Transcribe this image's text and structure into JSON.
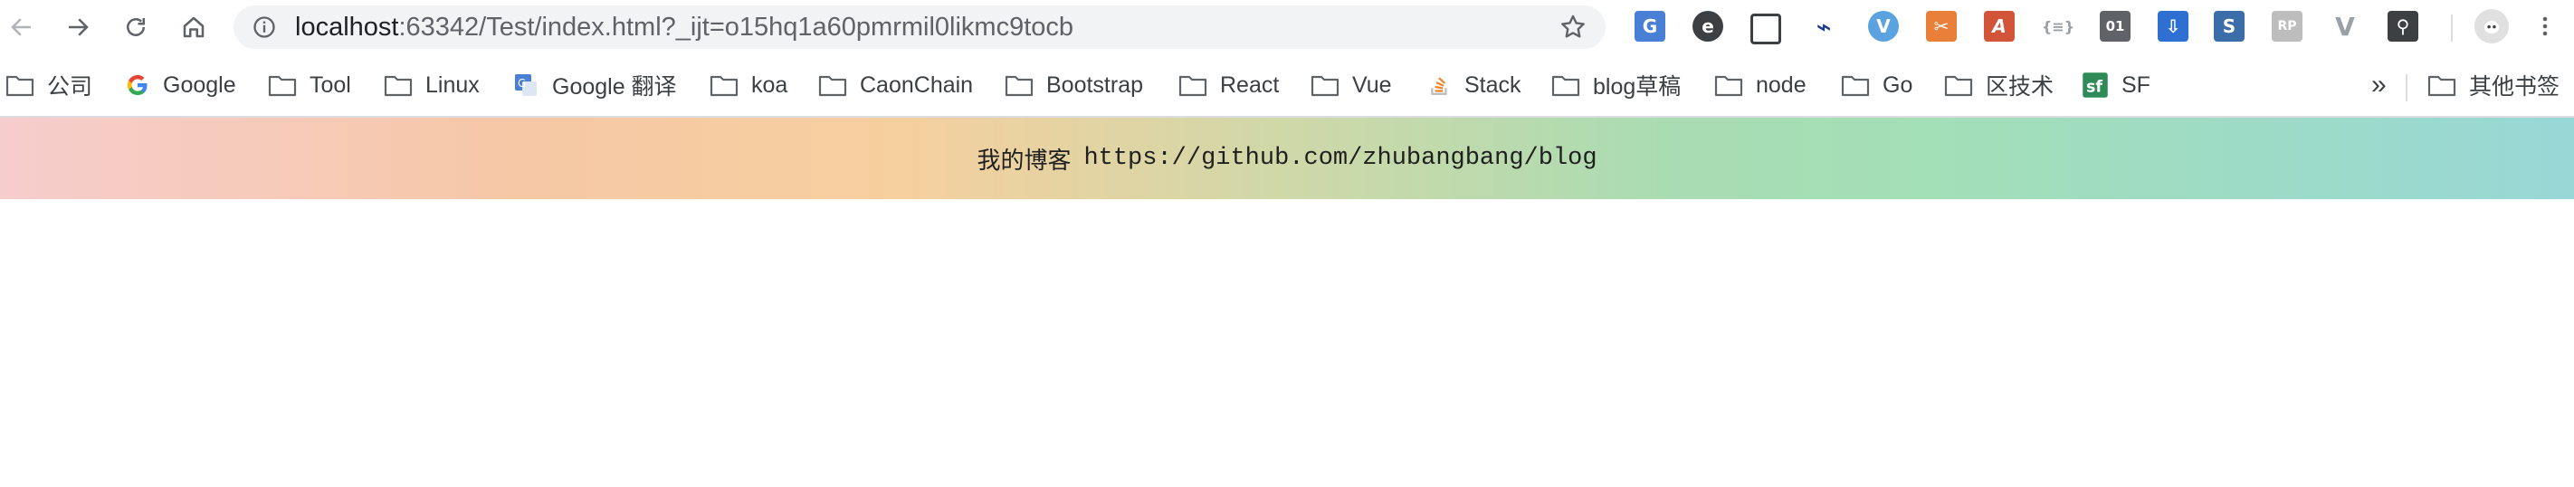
{
  "toolbar": {
    "back_icon": "arrow-left-icon",
    "forward_icon": "arrow-right-icon",
    "reload_icon": "reload-icon",
    "home_icon": "home-icon",
    "url_host": "localhost",
    "url_rest": ":63342/Test/index.html?_ijt=o15hq1a60pmrmil0likmc9tocb",
    "info_icon": "info-icon",
    "bookmark_star_icon": "star-icon"
  },
  "extensions": [
    {
      "name": "google-translate-ext",
      "glyph": "G",
      "color": "#4a7fd6"
    },
    {
      "name": "e-ext",
      "glyph": "e",
      "color": "#3c4043"
    },
    {
      "name": "screenshot-ext",
      "glyph": "▢",
      "color": "#3c4043"
    },
    {
      "name": "pin-ext",
      "glyph": "⌁",
      "color": "#1a3a8f"
    },
    {
      "name": "vimium-ext",
      "glyph": "V",
      "color": "#5aa3e0"
    },
    {
      "name": "tool-ext",
      "glyph": "✂",
      "color": "#e8803a"
    },
    {
      "name": "font-ext",
      "glyph": "A",
      "color": "#d2553a"
    },
    {
      "name": "json-ext",
      "glyph": "{≡}",
      "color": "#9aa0a6"
    },
    {
      "name": "binary-ext",
      "glyph": "01",
      "color": "#5f6368"
    },
    {
      "name": "save-ext",
      "glyph": "⇩",
      "color": "#2f6fd1"
    },
    {
      "name": "s-ext",
      "glyph": "S",
      "color": "#3b6ea8"
    },
    {
      "name": "rp-ext",
      "glyph": "RP",
      "color": "#bdbdbd"
    },
    {
      "name": "vue-devtools-ext",
      "glyph": "V",
      "color": "#9aa0a6"
    },
    {
      "name": "bulb-ext",
      "glyph": "⚲",
      "color": "#3c4043"
    }
  ],
  "profile_icon": "avatar-icon",
  "menu_icon": "kebab-menu-icon",
  "bookmarks": [
    {
      "label": "公司",
      "icon": "folder-icon"
    },
    {
      "label": "Google",
      "icon": "google-icon"
    },
    {
      "label": "Tool",
      "icon": "folder-icon"
    },
    {
      "label": "Linux",
      "icon": "folder-icon"
    },
    {
      "label": "Google 翻译",
      "icon": "translate-icon"
    },
    {
      "label": "koa",
      "icon": "folder-icon"
    },
    {
      "label": "CaonChain",
      "icon": "folder-icon"
    },
    {
      "label": "Bootstrap",
      "icon": "folder-icon"
    },
    {
      "label": "React",
      "icon": "folder-icon"
    },
    {
      "label": "Vue",
      "icon": "folder-icon"
    },
    {
      "label": "Stack",
      "icon": "stackoverflow-icon"
    },
    {
      "label": "blog草稿",
      "icon": "folder-icon"
    },
    {
      "label": "node",
      "icon": "folder-icon"
    },
    {
      "label": "Go",
      "icon": "folder-icon"
    },
    {
      "label": "区技术",
      "icon": "folder-icon"
    },
    {
      "label": "SF",
      "icon": "segmentfault-icon"
    }
  ],
  "bookmarks_more": "»",
  "other_bookmarks": {
    "label": "其他书签",
    "icon": "folder-icon"
  },
  "banner": {
    "text": "我的博客",
    "link": "https://github.com/zhubangbang/blog"
  }
}
